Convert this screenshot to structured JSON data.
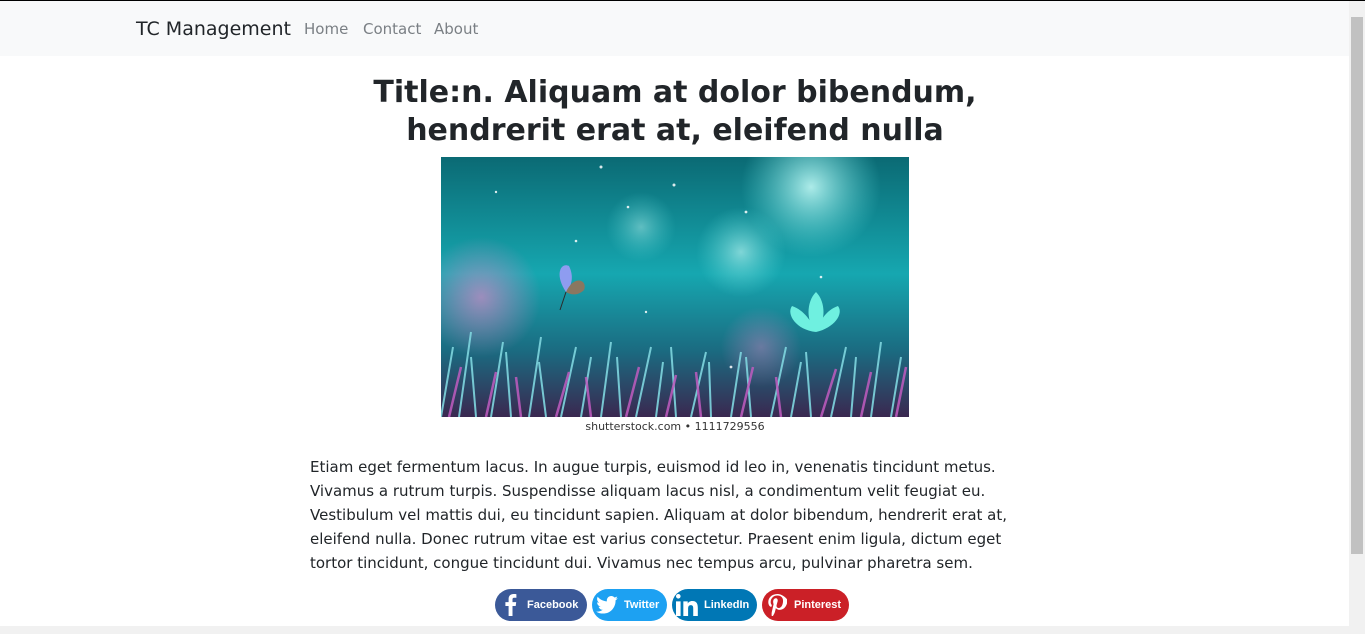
{
  "navbar": {
    "brand": "TC Management",
    "links": [
      {
        "label": "Home"
      },
      {
        "label": "Contact"
      },
      {
        "label": "About"
      }
    ]
  },
  "article": {
    "title": "Title:n. Aliquam at dolor bibendum, hendrerit erat at, eleifend nulla",
    "image_credit": "shutterstock.com • 1111729556",
    "body": "Etiam eget fermentum lacus. In augue turpis, euismod id leo in, venenatis tincidunt metus. Vivamus a rutrum turpis. Suspendisse aliquam lacus nisl, a condimentum velit feugiat eu. Vestibulum vel mattis dui, eu tincidunt sapien. Aliquam at dolor bibendum, hendrerit erat at, eleifend nulla. Donec rutrum vitae est varius consectetur. Praesent enim ligula, dictum eget tortor tincidunt, congue tincidunt dui. Vivamus nec tempus arcu, pulvinar pharetra sem."
  },
  "share": [
    {
      "label": "Facebook",
      "icon": "facebook-icon",
      "color": "#3b5998"
    },
    {
      "label": "Twitter",
      "icon": "twitter-icon",
      "color": "#1da1f2"
    },
    {
      "label": "LinkedIn",
      "icon": "linkedin-icon",
      "color": "#0077b5"
    },
    {
      "label": "Pinterest",
      "icon": "pinterest-icon",
      "color": "#cb2027"
    }
  ]
}
